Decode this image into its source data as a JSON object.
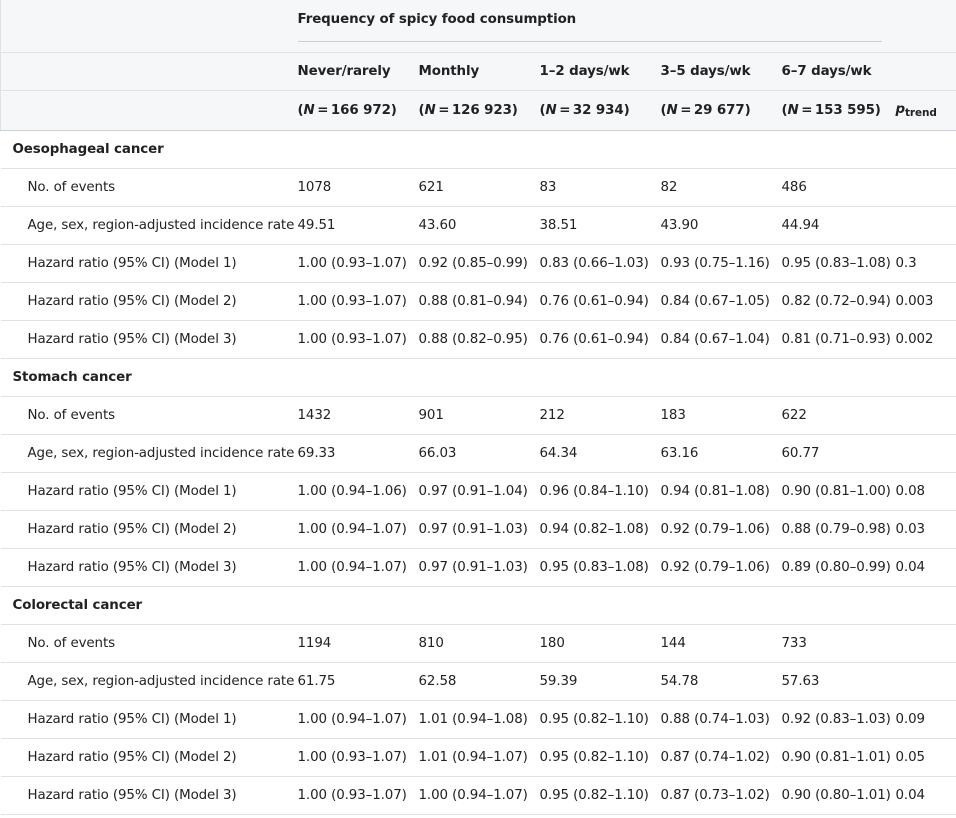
{
  "header": {
    "group_label": "Frequency of spicy food consumption",
    "columns": [
      {
        "label": "Never/rarely",
        "n_value": "166 972"
      },
      {
        "label": "Monthly",
        "n_value": "126 923"
      },
      {
        "label": "1–2 days/wk",
        "n_value": "32 934"
      },
      {
        "label": "3–5 days/wk",
        "n_value": "29 677"
      },
      {
        "label": "6–7 days/wk",
        "n_value": "153 595"
      }
    ],
    "n_prefix": "(",
    "n_symbol": "N",
    "n_equals": " = ",
    "n_suffix": ")",
    "ptrend_main": "p",
    "ptrend_sub": "trend"
  },
  "sections": [
    {
      "title": "Oesophageal cancer",
      "rows": [
        {
          "label": "No. of events",
          "values": [
            "1078",
            "621",
            "83",
            "82",
            "486"
          ],
          "ptrend": ""
        },
        {
          "label": "Age, sex, region-adjusted incidence rate",
          "values": [
            "49.51",
            "43.60",
            "38.51",
            "43.90",
            "44.94"
          ],
          "ptrend": ""
        },
        {
          "label": "Hazard ratio (95% CI) (Model 1)",
          "values": [
            "1.00 (0.93–1.07)",
            "0.92 (0.85–0.99)",
            "0.83 (0.66–1.03)",
            "0.93 (0.75–1.16)",
            "0.95 (0.83–1.08)"
          ],
          "ptrend": "0.3"
        },
        {
          "label": "Hazard ratio (95% CI) (Model 2)",
          "values": [
            "1.00 (0.93–1.07)",
            "0.88 (0.81–0.94)",
            "0.76 (0.61–0.94)",
            "0.84 (0.67–1.05)",
            "0.82 (0.72–0.94)"
          ],
          "ptrend": "0.003"
        },
        {
          "label": "Hazard ratio (95% CI) (Model 3)",
          "values": [
            "1.00 (0.93–1.07)",
            "0.88 (0.82–0.95)",
            "0.76 (0.61–0.94)",
            "0.84 (0.67–1.04)",
            "0.81 (0.71–0.93)"
          ],
          "ptrend": "0.002"
        }
      ]
    },
    {
      "title": "Stomach cancer",
      "rows": [
        {
          "label": "No. of events",
          "values": [
            "1432",
            "901",
            "212",
            "183",
            "622"
          ],
          "ptrend": ""
        },
        {
          "label": "Age, sex, region-adjusted incidence rate",
          "values": [
            "69.33",
            "66.03",
            "64.34",
            "63.16",
            "60.77"
          ],
          "ptrend": ""
        },
        {
          "label": "Hazard ratio (95% CI) (Model 1)",
          "values": [
            "1.00 (0.94–1.06)",
            "0.97 (0.91–1.04)",
            "0.96 (0.84–1.10)",
            "0.94 (0.81–1.08)",
            "0.90 (0.81–1.00)"
          ],
          "ptrend": "0.08"
        },
        {
          "label": "Hazard ratio (95% CI) (Model 2)",
          "values": [
            "1.00 (0.94–1.07)",
            "0.97 (0.91–1.03)",
            "0.94 (0.82–1.08)",
            "0.92 (0.79–1.06)",
            "0.88 (0.79–0.98)"
          ],
          "ptrend": "0.03"
        },
        {
          "label": "Hazard ratio (95% CI) (Model 3)",
          "values": [
            "1.00 (0.94–1.07)",
            "0.97 (0.91–1.03)",
            "0.95 (0.83–1.08)",
            "0.92 (0.79–1.06)",
            "0.89 (0.80–0.99)"
          ],
          "ptrend": "0.04"
        }
      ]
    },
    {
      "title": "Colorectal cancer",
      "rows": [
        {
          "label": "No. of events",
          "values": [
            "1194",
            "810",
            "180",
            "144",
            "733"
          ],
          "ptrend": ""
        },
        {
          "label": "Age, sex, region-adjusted incidence rate",
          "values": [
            "61.75",
            "62.58",
            "59.39",
            "54.78",
            "57.63"
          ],
          "ptrend": ""
        },
        {
          "label": "Hazard ratio (95% CI) (Model 1)",
          "values": [
            "1.00 (0.94–1.07)",
            "1.01 (0.94–1.08)",
            "0.95 (0.82–1.10)",
            "0.88 (0.74–1.03)",
            "0.92 (0.83–1.03)"
          ],
          "ptrend": "0.09"
        },
        {
          "label": "Hazard ratio (95% CI) (Model 2)",
          "values": [
            "1.00 (0.93–1.07)",
            "1.01 (0.94–1.07)",
            "0.95 (0.82–1.10)",
            "0.87 (0.74–1.02)",
            "0.90 (0.81–1.01)"
          ],
          "ptrend": "0.05"
        },
        {
          "label": "Hazard ratio (95% CI) (Model 3)",
          "values": [
            "1.00 (0.93–1.07)",
            "1.00 (0.94–1.07)",
            "0.95 (0.82–1.10)",
            "0.87 (0.73–1.02)",
            "0.90 (0.80–1.01)"
          ],
          "ptrend": "0.04"
        }
      ]
    }
  ]
}
